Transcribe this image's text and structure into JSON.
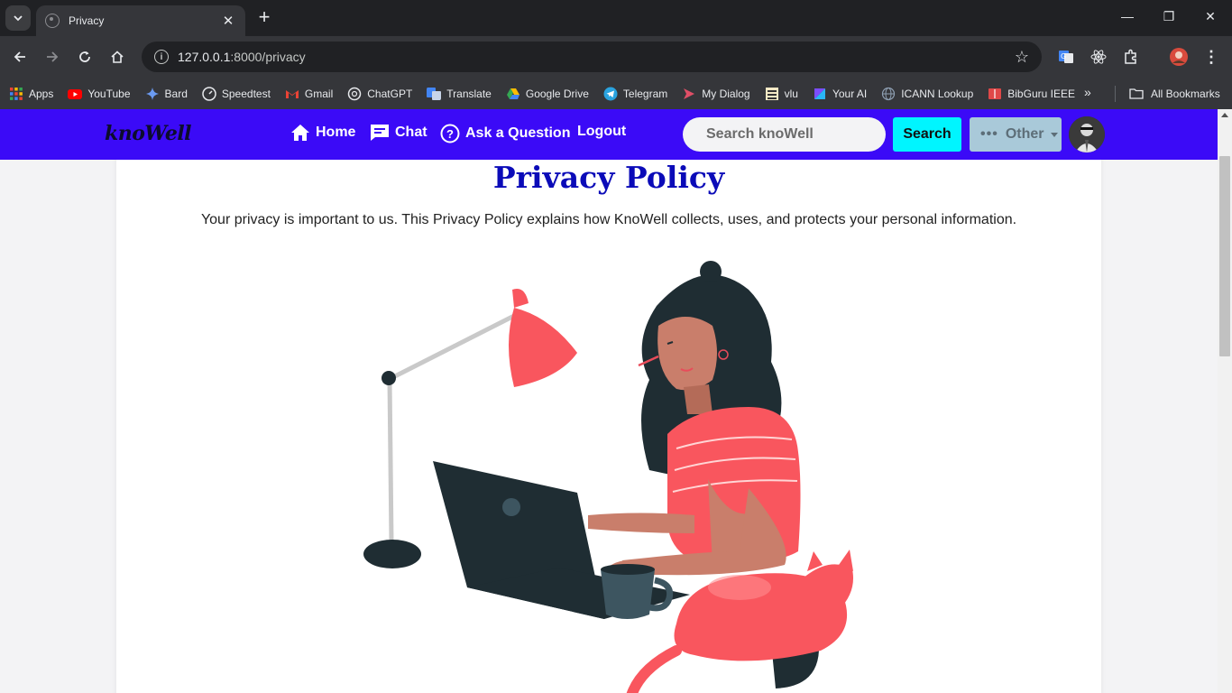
{
  "browser": {
    "tab_title": "Privacy",
    "url_host": "127.0.0.1",
    "url_path": ":8000/privacy",
    "bookmarks": [
      "Apps",
      "YouTube",
      "Bard",
      "Speedtest",
      "Gmail",
      "ChatGPT",
      "Translate",
      "Google Drive",
      "Telegram",
      "My Dialog",
      "vlu",
      "Your  AI",
      "ICANN Lookup",
      "BibGuru IEEE"
    ],
    "all_bookmarks": "All Bookmarks"
  },
  "site": {
    "brand": "knoWell",
    "nav": {
      "home": "Home",
      "chat": "Chat",
      "ask": "Ask a Question",
      "logout": "Logout"
    },
    "search_placeholder": "Search knoWell",
    "search_button": "Search",
    "other_button": "Other",
    "accent_color": "#3b0af7"
  },
  "page": {
    "title": "Privacy Policy",
    "description": "Your privacy is important to us. This Privacy Policy explains how KnoWell collects, uses, and protects your personal information."
  }
}
